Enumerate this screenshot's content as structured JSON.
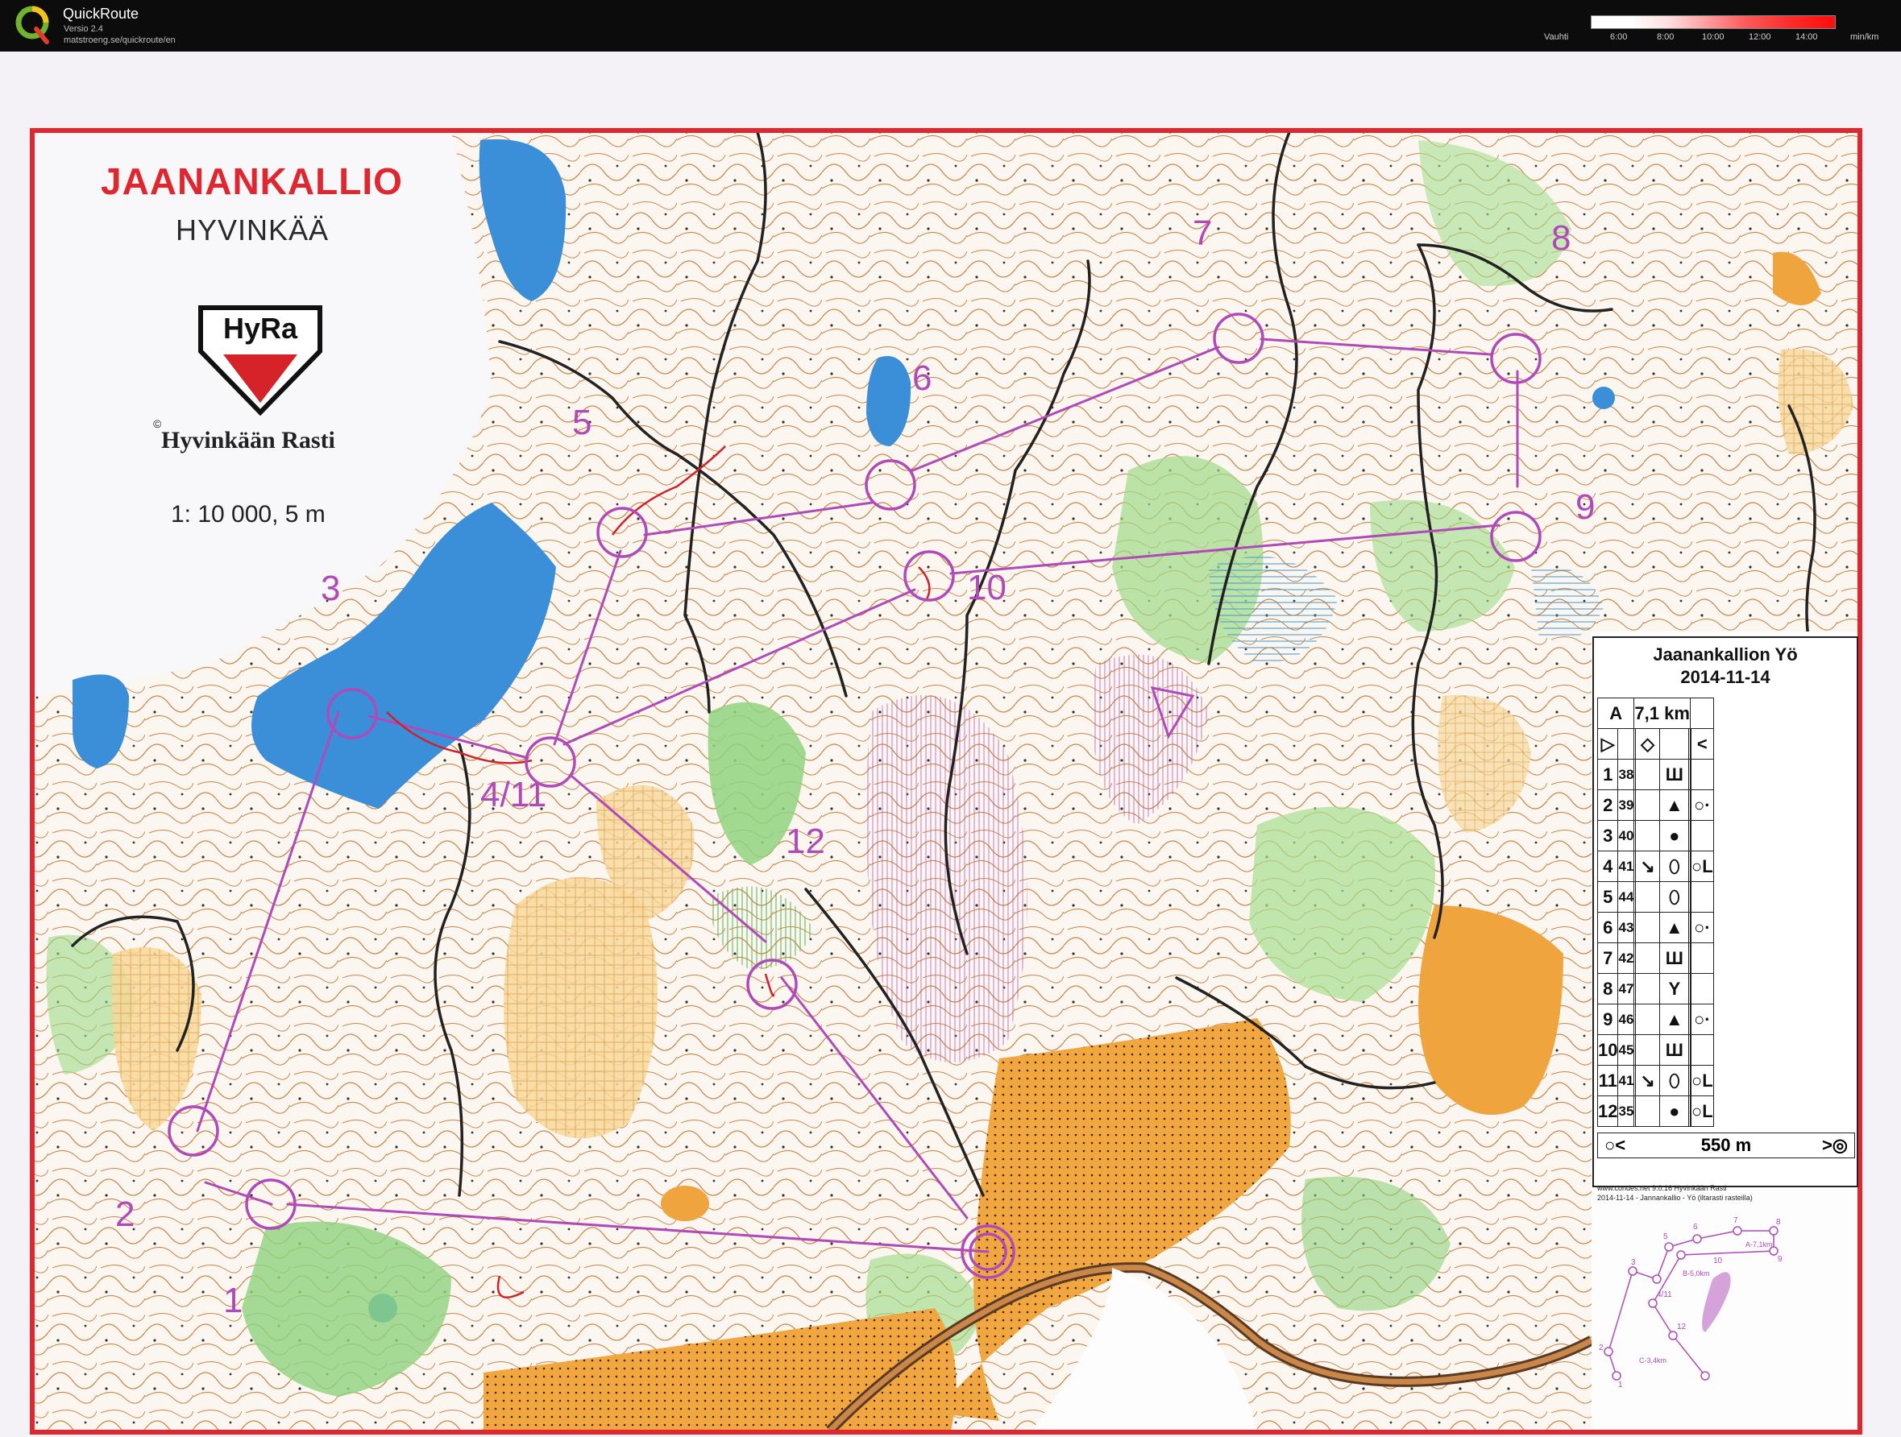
{
  "app": {
    "title": "QuickRoute",
    "version": "Versio 2.4",
    "url": "matstroeng.se/quickroute/en"
  },
  "pace_legend": {
    "label": "Vauhti",
    "ticks": [
      "6:00",
      "8:00",
      "10:00",
      "12:00",
      "14:00"
    ],
    "unit": "min/km",
    "colors": {
      "slow": "#ff0c0c",
      "fast": "#ffffff"
    }
  },
  "map": {
    "title": "JAANANKALLIO",
    "subtitle": "HYVINKÄÄ",
    "logo_text": "HyRa",
    "copyright_mark": "©",
    "club": "Hyvinkään Rasti",
    "scale": "1: 10 000, 5 m",
    "course_color": "#b04ab8",
    "border_color": "#e0262f",
    "controls": [
      {
        "label": "1"
      },
      {
        "label": "2"
      },
      {
        "label": "3"
      },
      {
        "label": "4/11"
      },
      {
        "label": "5"
      },
      {
        "label": "6"
      },
      {
        "label": "7"
      },
      {
        "label": "8"
      },
      {
        "label": "9"
      },
      {
        "label": "10"
      },
      {
        "label": "12"
      }
    ]
  },
  "description_sheet": {
    "title": "Jaanankallion Yö",
    "date": "2014-11-14",
    "class": "A",
    "length": "7,1 km",
    "rows": [
      {
        "n": "1",
        "code": "38",
        "dir": "",
        "feature": "Ш",
        "extra": ""
      },
      {
        "n": "2",
        "code": "39",
        "dir": "",
        "feature": "▲",
        "extra": "○·"
      },
      {
        "n": "3",
        "code": "40",
        "dir": "",
        "feature": "●",
        "extra": ""
      },
      {
        "n": "4",
        "code": "41",
        "dir": "↘",
        "feature": "⬯",
        "extra": "○L"
      },
      {
        "n": "5",
        "code": "44",
        "dir": "",
        "feature": "⬯",
        "extra": ""
      },
      {
        "n": "6",
        "code": "43",
        "dir": "",
        "feature": "▲",
        "extra": "○·"
      },
      {
        "n": "7",
        "code": "42",
        "dir": "",
        "feature": "Ш",
        "extra": ""
      },
      {
        "n": "8",
        "code": "47",
        "dir": "",
        "feature": "Y",
        "extra": ""
      },
      {
        "n": "9",
        "code": "46",
        "dir": "",
        "feature": "▲",
        "extra": "○·"
      },
      {
        "n": "10",
        "code": "45",
        "dir": "",
        "feature": "Ш",
        "extra": ""
      },
      {
        "n": "11",
        "code": "41",
        "dir": "↘",
        "feature": "⬯",
        "extra": "○L"
      },
      {
        "n": "12",
        "code": "35",
        "dir": "",
        "feature": "●",
        "extra": "○L"
      }
    ],
    "finish_distance": "550 m",
    "print_url": "www.condes.net 9.0.16 Hyvinkään Rasti",
    "print_event": "2014-11-14 - Jannankallio - Yö (iltarasti rasteilla)"
  },
  "inset": {
    "labels": [
      "5",
      "6",
      "7",
      "8",
      "9",
      "10",
      "4/11",
      "12",
      "1",
      "2",
      "3"
    ],
    "course_labels": [
      "A-7,1km",
      "B-5,0km",
      "C-3,4km"
    ]
  }
}
